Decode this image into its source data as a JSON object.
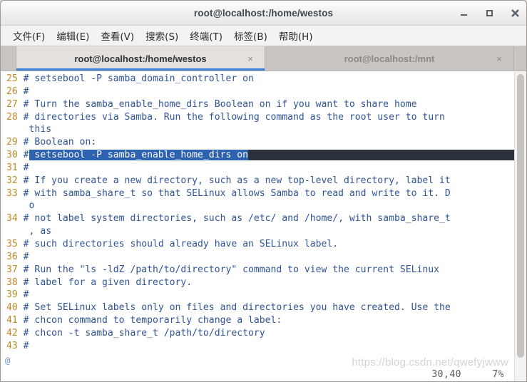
{
  "window": {
    "title": "root@localhost:/home/westos",
    "controls": {
      "minimize": "–",
      "maximize": "□",
      "close": "×"
    }
  },
  "menubar": {
    "items": [
      {
        "label": "文件(F)"
      },
      {
        "label": "编辑(E)"
      },
      {
        "label": "查看(V)"
      },
      {
        "label": "搜索(S)"
      },
      {
        "label": "终端(T)"
      },
      {
        "label": "标签(B)"
      },
      {
        "label": "帮助(H)"
      }
    ]
  },
  "tabs": {
    "close_glyph": "×",
    "items": [
      {
        "label": "root@localhost:/home/westos",
        "active": true
      },
      {
        "label": "root@localhost:/mnt",
        "active": false
      }
    ]
  },
  "editor": {
    "at_marker": "@",
    "lines": [
      {
        "num": "25",
        "hash": "#",
        "text": " setsebool -P samba_domain_controller on"
      },
      {
        "num": "26",
        "hash": "#",
        "text": ""
      },
      {
        "num": "27",
        "hash": "#",
        "text": " Turn the samba_enable_home_dirs Boolean on if you want to share home"
      },
      {
        "num": "28",
        "hash": "#",
        "text": " directories via Samba. Run the following command as the root user to turn"
      },
      {
        "num": "",
        "hash": "",
        "text": "this"
      },
      {
        "num": "29",
        "hash": "#",
        "text": " Boolean on:"
      },
      {
        "num": "30",
        "hash": "#",
        "text": " setsebool -P samba_enable_home_dirs on",
        "selected": true
      },
      {
        "num": "31",
        "hash": "#",
        "text": ""
      },
      {
        "num": "32",
        "hash": "#",
        "text": " If you create a new directory, such as a new top-level directory, label it"
      },
      {
        "num": "33",
        "hash": "#",
        "text": " with samba_share_t so that SELinux allows Samba to read and write to it. D"
      },
      {
        "num": "",
        "hash": "",
        "text": "o"
      },
      {
        "num": "34",
        "hash": "#",
        "text": " not label system directories, such as /etc/ and /home/, with samba_share_t"
      },
      {
        "num": "",
        "hash": "",
        "text": ", as"
      },
      {
        "num": "35",
        "hash": "#",
        "text": " such directories should already have an SELinux label."
      },
      {
        "num": "36",
        "hash": "#",
        "text": ""
      },
      {
        "num": "37",
        "hash": "#",
        "text": " Run the \"ls -ldZ /path/to/directory\" command to view the current SELinux"
      },
      {
        "num": "38",
        "hash": "#",
        "text": " label for a given directory."
      },
      {
        "num": "39",
        "hash": "#",
        "text": ""
      },
      {
        "num": "40",
        "hash": "#",
        "text": " Set SELinux labels only on files and directories you have created. Use the"
      },
      {
        "num": "41",
        "hash": "#",
        "text": " chcon command to temporarily change a label:"
      },
      {
        "num": "42",
        "hash": "#",
        "text": " chcon -t samba_share_t /path/to/directory"
      },
      {
        "num": "43",
        "hash": "#",
        "text": ""
      }
    ]
  },
  "statusbar": {
    "position": "30,40",
    "percent": "7%"
  },
  "watermark": {
    "text": "https://blog.csdn.net/qwefyjwww"
  },
  "colors": {
    "selection_bg": "#2d62b0",
    "selection_fg": "#ffffff",
    "comment_fg": "#2f5496",
    "linenumber_fg": "#c08a28",
    "eol_fill": "#2c323c",
    "tab_accent": "#3b7fd4",
    "terminal_bg": "#ffffff"
  }
}
